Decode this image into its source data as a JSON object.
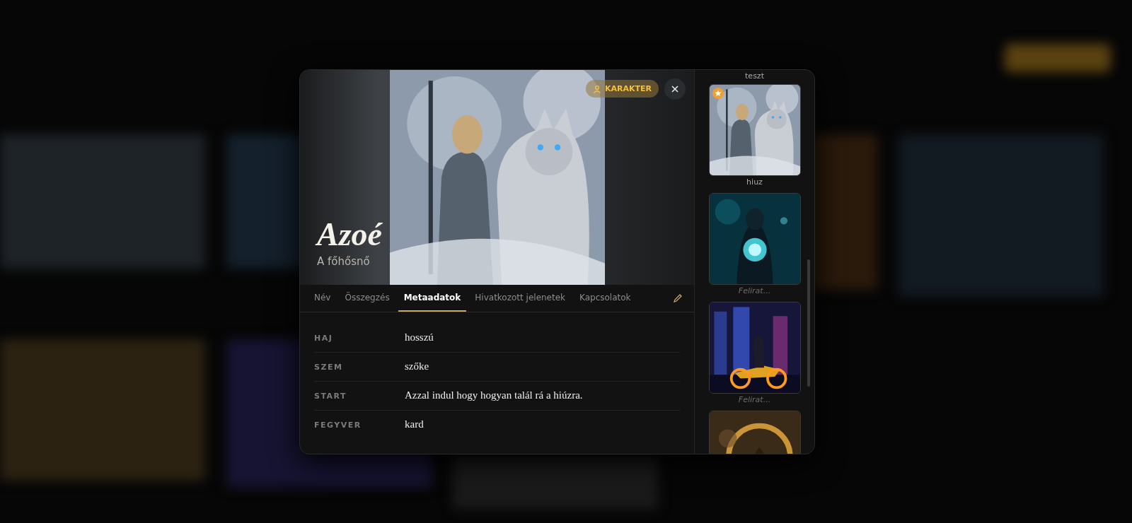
{
  "character": {
    "name": "Azoé",
    "subtitle": "A főhősnő",
    "badge": "KARAKTER"
  },
  "tabs": [
    {
      "label": "Név",
      "selected": false
    },
    {
      "label": "Összegzés",
      "selected": false
    },
    {
      "label": "Metaadatok",
      "selected": true
    },
    {
      "label": "Hivatkozott jelenetek",
      "selected": false
    },
    {
      "label": "Kapcsolatok",
      "selected": false
    }
  ],
  "metadata": [
    {
      "key": "HAJ",
      "value": "hosszú"
    },
    {
      "key": "SZEM",
      "value": "szőke"
    },
    {
      "key": "START",
      "value": "Azzal indul hogy hogyan talál rá a hiúzra."
    },
    {
      "key": "FEGYVER",
      "value": "kard"
    }
  ],
  "gallery": {
    "top_caption": "teszt",
    "images": [
      {
        "favorite": true,
        "caption": "hiuz"
      },
      {
        "favorite": false,
        "placeholder": "Felirat..."
      },
      {
        "favorite": false,
        "placeholder": "Felirat..."
      },
      {
        "favorite": false
      }
    ]
  }
}
